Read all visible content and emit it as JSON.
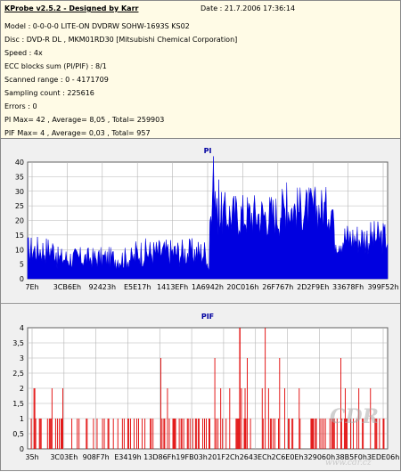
{
  "header": {
    "title": "KProbe v2.5.2 - Designed by Karr",
    "date": "Date : 21.7.2006 17:36:14",
    "lines": [
      "Model : 0-0-0-0 LITE-ON DVDRW SOHW-1693S KS02",
      "Disc : DVD-R DL , MKM01RD30 [Mitsubishi Chemical Corporation]",
      "Speed : 4x",
      "ECC blocks sum (PI/PIF) : 8/1",
      "Scanned range : 0 - 4171709",
      "Sampling count : 225616",
      "Errors : 0",
      "PI Max= 42 , Average= 8,05 , Total= 259903",
      "PIF Max= 4 , Average= 0,03 , Total= 957"
    ]
  },
  "colors": {
    "pi": "#0000e0",
    "pif": "#e00000",
    "title": "#0000a0",
    "grid": "#b4b4b4"
  },
  "chart_data": [
    {
      "type": "area",
      "title": "PI",
      "ylim": [
        0,
        40
      ],
      "yticks": [
        0,
        5,
        10,
        15,
        20,
        25,
        30,
        35,
        40
      ],
      "grid": true,
      "xlabels": [
        "7Eh",
        "3CB6Eh",
        "92423h",
        "E5E17h",
        "1413EFh",
        "1A6942h",
        "20C016h",
        "26F767h",
        "2D2F9Eh",
        "33678Fh",
        "399F52h"
      ],
      "series": [
        {
          "segments": [
            {
              "from": 0.0,
              "to": 0.08,
              "base": 10,
              "noise": 5
            },
            {
              "from": 0.08,
              "to": 0.3,
              "base": 7,
              "noise": 4
            },
            {
              "from": 0.3,
              "to": 0.5,
              "base": 9,
              "noise": 5
            },
            {
              "from": 0.5,
              "to": 0.505,
              "base": 4,
              "noise": 2
            },
            {
              "from": 0.505,
              "to": 0.7,
              "base": 22,
              "noise": 8
            },
            {
              "from": 0.7,
              "to": 0.85,
              "base": 24,
              "noise": 8
            },
            {
              "from": 0.85,
              "to": 1.0,
              "base": 14,
              "noise": 6
            }
          ],
          "peaks": [
            [
              0.515,
              42
            ],
            [
              0.53,
              34
            ],
            [
              0.52,
              30
            ],
            [
              0.72,
              33
            ]
          ]
        }
      ]
    },
    {
      "type": "bar",
      "title": "PIF",
      "ylim": [
        0,
        4
      ],
      "yticks": [
        0,
        0.5,
        1,
        1.5,
        2,
        2.5,
        3,
        3.5,
        4
      ],
      "ytick_labels": [
        "0",
        "0,5",
        "1",
        "1,5",
        "2",
        "2,5",
        "3",
        "3,5",
        "4"
      ],
      "grid": true,
      "xlabels": [
        "35h",
        "3C03Eh",
        "908F7h",
        "E3419h",
        "13D86Fh",
        "19FB03h",
        "201F2Ch",
        "2643ECh",
        "2C6E0Eh",
        "329060h",
        "38B5F0h",
        "3EDE06h"
      ],
      "series": [
        {
          "density": 0.35,
          "twos_ratio": 0.15,
          "spikes": [
            [
              0.37,
              3
            ],
            [
              0.52,
              3
            ],
            [
              0.59,
              4
            ],
            [
              0.61,
              3
            ],
            [
              0.66,
              4
            ],
            [
              0.7,
              3
            ],
            [
              0.87,
              3
            ],
            [
              0.92,
              2
            ]
          ]
        }
      ]
    }
  ],
  "watermark": "CDR",
  "watermark_url": "www.cdr.cz"
}
